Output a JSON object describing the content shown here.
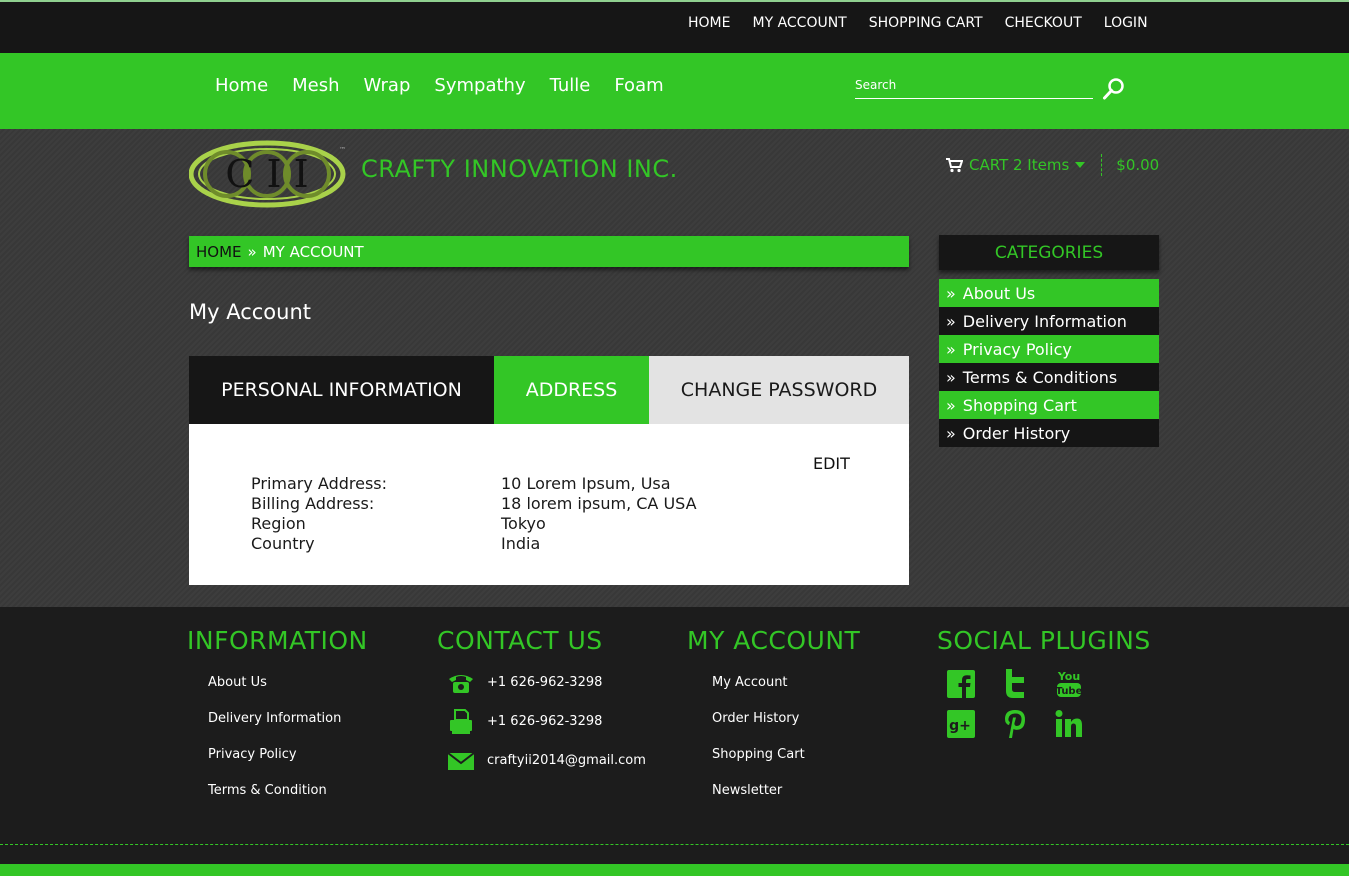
{
  "top_links": [
    "HOME",
    "MY ACCOUNT",
    "SHOPPING CART",
    "CHECKOUT",
    "LOGIN"
  ],
  "main_nav": [
    "Home",
    "Mesh",
    "Wrap",
    "Sympathy",
    "Tulle",
    "Foam"
  ],
  "search": {
    "placeholder": "Search"
  },
  "brand": {
    "logo_text": "C I I",
    "name": "CRAFTY INNOVATION INC."
  },
  "cart": {
    "label": "CART 2 Items",
    "total": "$0.00"
  },
  "breadcrumb": {
    "home": "HOME",
    "separator": "»",
    "current": "MY ACCOUNT"
  },
  "page_title": "My Account",
  "tabs": {
    "personal": "PERSONAL INFORMATION",
    "address": "ADDRESS",
    "password": "CHANGE PASSWORD"
  },
  "address_panel": {
    "edit": "EDIT",
    "rows": [
      {
        "label": "Primary Address:",
        "value": "10 Lorem Ipsum, Usa"
      },
      {
        "label": "Billing Address:",
        "value": "18 lorem ipsum, CA USA"
      },
      {
        "label": "Region",
        "value": "Tokyo"
      },
      {
        "label": "Country",
        "value": "India"
      }
    ]
  },
  "categories": {
    "title": "CATEGORIES",
    "items": [
      "About Us",
      "Delivery Information",
      "Privacy Policy",
      "Terms & Conditions",
      "Shopping Cart",
      "Order History"
    ]
  },
  "footer": {
    "information": {
      "title": "INFORMATION",
      "links": [
        "About Us",
        "Delivery Information",
        "Privacy Policy",
        "Terms & Condition"
      ]
    },
    "contact": {
      "title": "CONTACT US",
      "phone": "+1 626-962-3298",
      "fax": "+1 626-962-3298",
      "email": "craftyii2014@gmail.com"
    },
    "account": {
      "title": "MY ACCOUNT",
      "links": [
        "My Account",
        "Order History",
        "Shopping Cart",
        "Newsletter"
      ]
    },
    "social": {
      "title": "SOCIAL PLUGINS",
      "icons": [
        "facebook-icon",
        "twitter-icon",
        "youtube-icon",
        "google-plus-icon",
        "pinterest-icon",
        "linkedin-icon"
      ],
      "youtube_text": "You Tube"
    }
  },
  "colors": {
    "accent": "#33c626",
    "dark": "#161616",
    "background": "#3b3b3b"
  }
}
